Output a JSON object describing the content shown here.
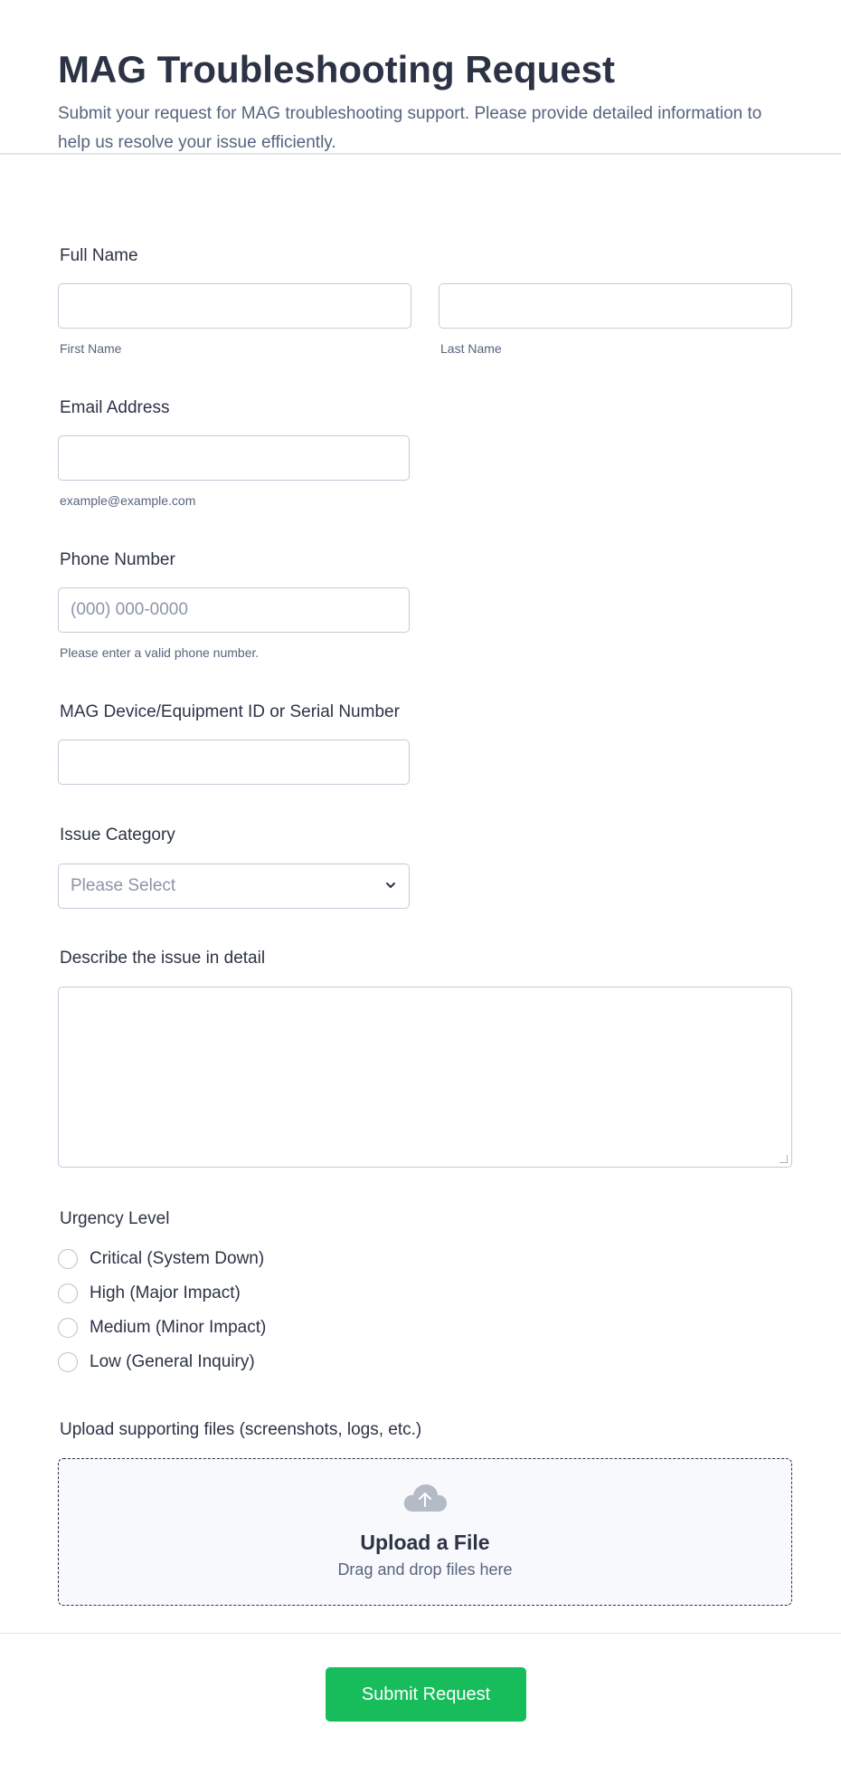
{
  "header": {
    "title": "MAG Troubleshooting Request",
    "subtitle": "Submit your request for MAG troubleshooting support. Please provide detailed information to help us resolve your issue efficiently."
  },
  "full_name": {
    "label": "Full Name",
    "first_sublabel": "First Name",
    "last_sublabel": "Last Name"
  },
  "email": {
    "label": "Email Address",
    "sublabel": "example@example.com"
  },
  "phone": {
    "label": "Phone Number",
    "placeholder": "(000) 000-0000",
    "sublabel": "Please enter a valid phone number."
  },
  "device_id": {
    "label": "MAG Device/Equipment ID or Serial Number"
  },
  "issue_category": {
    "label": "Issue Category",
    "selected": "Please Select"
  },
  "description": {
    "label": "Describe the issue in detail"
  },
  "urgency": {
    "label": "Urgency Level",
    "options": [
      "Critical (System Down)",
      "High (Major Impact)",
      "Medium (Minor Impact)",
      "Low (General Inquiry)"
    ]
  },
  "upload": {
    "label": "Upload supporting files (screenshots, logs, etc.)",
    "title": "Upload a File",
    "subtitle": "Drag and drop files here",
    "icon": "cloud-upload-icon"
  },
  "submit": {
    "label": "Submit Request"
  },
  "colors": {
    "accent": "#18bd5b",
    "text": "#2c3345",
    "muted": "#57647e"
  }
}
